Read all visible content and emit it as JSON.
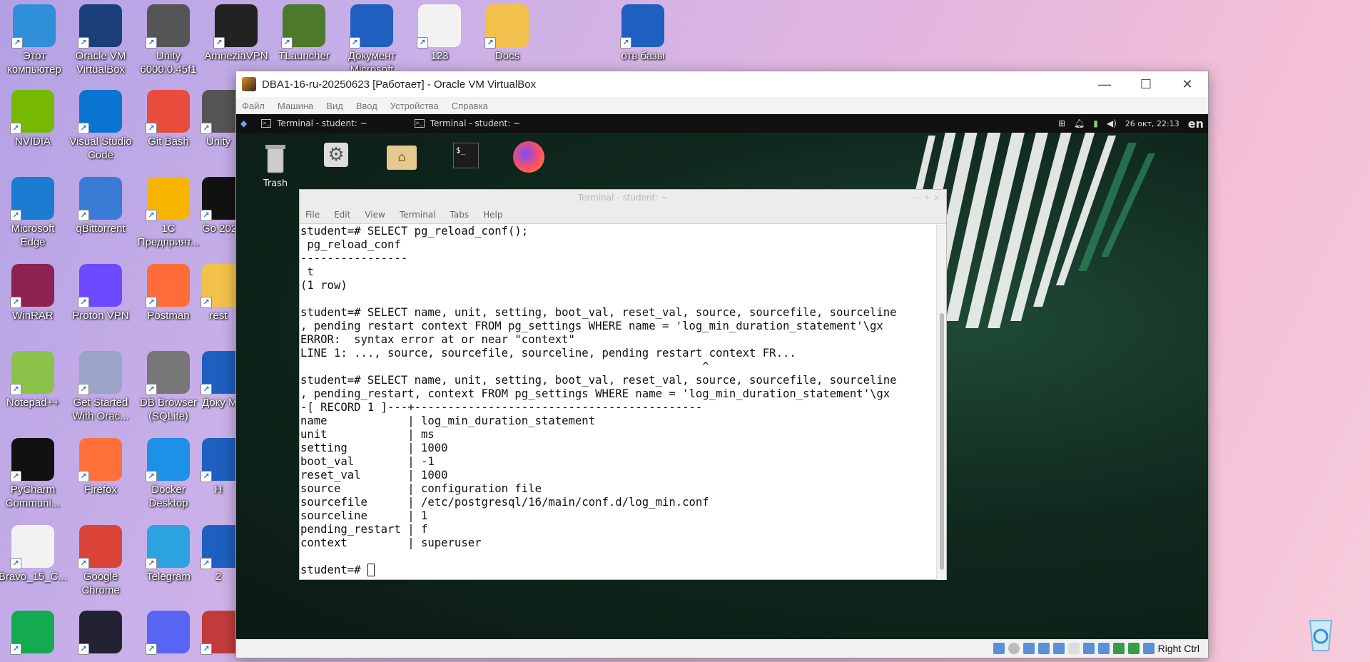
{
  "desktop_icons": [
    {
      "id": "this-pc",
      "label": "Этот компьютер",
      "color": "#2f8fd8"
    },
    {
      "id": "virtualbox",
      "label": "Oracle VM VirtualBox",
      "color": "#1b3f7a"
    },
    {
      "id": "unity",
      "label": "Unity 6000.0.45f1",
      "color": "#555"
    },
    {
      "id": "amnezia",
      "label": "AmneziaVPN",
      "color": "#222"
    },
    {
      "id": "tlauncher",
      "label": "TLauncher",
      "color": "#4c7a2a"
    },
    {
      "id": "word-doc",
      "label": "Документ Microsoft",
      "color": "#1f5fbf"
    },
    {
      "id": "file-123",
      "label": "123",
      "color": "#f2f2f2"
    },
    {
      "id": "docs",
      "label": "Docs",
      "color": "#f2c14b"
    },
    {
      "id": "word-otv",
      "label": "отв базы",
      "color": "#1f5fbf"
    },
    {
      "id": "nvidia",
      "label": "NVIDIA",
      "color": "#76b900"
    },
    {
      "id": "vscode",
      "label": "Visual Studio Code",
      "color": "#0a74d1"
    },
    {
      "id": "gitbash",
      "label": "Git Bash",
      "color": "#e84c3d"
    },
    {
      "id": "unity-hub",
      "label": "Unity",
      "color": "#555"
    },
    {
      "id": "edge",
      "label": "Microsoft Edge",
      "color": "#1a7bd1"
    },
    {
      "id": "qbittorrent",
      "label": "qBittorrent",
      "color": "#3a7bd5"
    },
    {
      "id": "1c",
      "label": "1С Предприят...",
      "color": "#f7b500"
    },
    {
      "id": "go",
      "label": "Go 202",
      "color": "#111"
    },
    {
      "id": "winrar",
      "label": "WinRAR",
      "color": "#8b2252"
    },
    {
      "id": "protonvpn",
      "label": "Proton VPN",
      "color": "#6d4aff"
    },
    {
      "id": "postman",
      "label": "Postman",
      "color": "#ff6c37"
    },
    {
      "id": "rest",
      "label": "rest",
      "color": "#f2c14b"
    },
    {
      "id": "notepadpp",
      "label": "Notepad++",
      "color": "#8bc34a"
    },
    {
      "id": "oracle-xe",
      "label": "Get Started With Orac...",
      "color": "#9aa4c8"
    },
    {
      "id": "dbbrowser",
      "label": "DB Browser (SQLite)",
      "color": "#777"
    },
    {
      "id": "word-docu",
      "label": "Доку Micro",
      "color": "#1f5fbf"
    },
    {
      "id": "pycharm",
      "label": "PyCharm Communi...",
      "color": "#111"
    },
    {
      "id": "firefox",
      "label": "Firefox",
      "color": "#ff7139"
    },
    {
      "id": "docker",
      "label": "Docker Desktop",
      "color": "#1d91e6"
    },
    {
      "id": "word-h",
      "label": "H",
      "color": "#1f5fbf"
    },
    {
      "id": "bravo",
      "label": "Bravo_15_C...",
      "color": "#f2f2f2"
    },
    {
      "id": "chrome",
      "label": "Google Chrome",
      "color": "#db4437"
    },
    {
      "id": "telegram",
      "label": "Telegram",
      "color": "#2aa3e0"
    },
    {
      "id": "word-2",
      "label": "2",
      "color": "#1f5fbf"
    },
    {
      "id": "mongodb",
      "label": "",
      "color": "#13aa52"
    },
    {
      "id": "game",
      "label": "",
      "color": "#223"
    },
    {
      "id": "discord",
      "label": "",
      "color": "#5865f2"
    },
    {
      "id": "dbx",
      "label": "",
      "color": "#c23b3b"
    }
  ],
  "recycle_bin": {
    "color": "#6bb7e8"
  },
  "vbox": {
    "title": "DBA1-16-ru-20250623 [Работает] - Oracle VM VirtualBox",
    "menu": [
      "Файл",
      "Машина",
      "Вид",
      "Ввод",
      "Устройства",
      "Справка"
    ],
    "status_text": "Right Ctrl"
  },
  "guest": {
    "tasks": [
      "Terminal - student: ~",
      "Terminal - student: ~"
    ],
    "clock": "26 окт, 22:13",
    "lang": "en",
    "trash_label": "Trash"
  },
  "terminal": {
    "title": "Terminal - student: ~",
    "menu": [
      "File",
      "Edit",
      "View",
      "Terminal",
      "Tabs",
      "Help"
    ],
    "lines": [
      "student=# SELECT pg_reload_conf();",
      " pg_reload_conf",
      "----------------",
      " t",
      "(1 row)",
      "",
      "student=# SELECT name, unit, setting, boot_val, reset_val, source, sourcefile, sourceline",
      ", pending restart context FROM pg_settings WHERE name = 'log_min_duration_statement'\\gx",
      "ERROR:  syntax error at or near \"context\"",
      "LINE 1: ..., source, sourcefile, sourceline, pending restart context FR...",
      "                                                            ^",
      "student=# SELECT name, unit, setting, boot_val, reset_val, source, sourcefile, sourceline",
      ", pending_restart, context FROM pg_settings WHERE name = 'log_min_duration_statement'\\gx",
      "-[ RECORD 1 ]---+-------------------------------------------",
      "name            | log_min_duration_statement",
      "unit            | ms",
      "setting         | 1000",
      "boot_val        | -1",
      "reset_val       | 1000",
      "source          | configuration file",
      "sourcefile      | /etc/postgresql/16/main/conf.d/log_min.conf",
      "sourceline      | 1",
      "pending_restart | f",
      "context         | superuser",
      ""
    ],
    "prompt": "student=# "
  }
}
